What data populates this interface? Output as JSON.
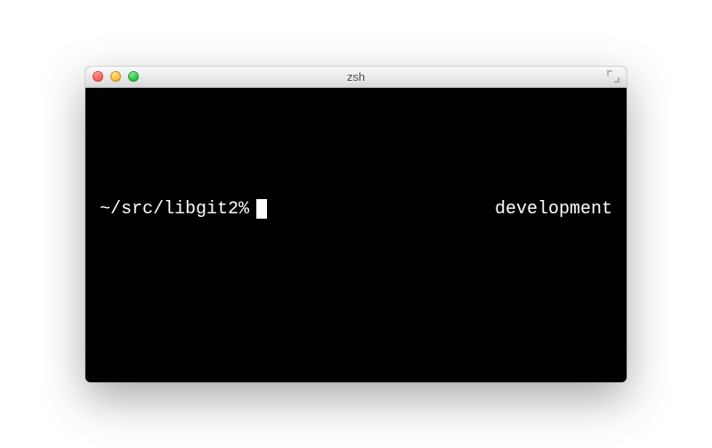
{
  "window": {
    "title": "zsh"
  },
  "terminal": {
    "prompt": "~/src/libgit2%",
    "right_prompt": "development"
  }
}
